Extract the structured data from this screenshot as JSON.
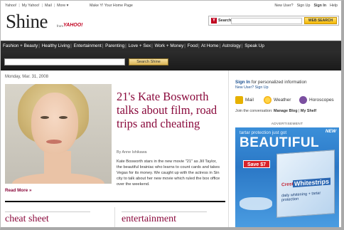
{
  "topbar": {
    "links": [
      "Yahoo!",
      "My Yahoo!",
      "Mail",
      "More ▾"
    ],
    "make_home": "Make Y! Your Home Page",
    "new_user": "New User?",
    "sign_up": "Sign Up",
    "sign_in": "Sign In",
    "help": "Help"
  },
  "brand": {
    "logo": "Shine",
    "from": "from",
    "yahoo": "YAHOO!"
  },
  "web_search": {
    "label": "Search",
    "value": "",
    "button": "WEB SEARCH"
  },
  "nav": {
    "items": [
      "Fashion + Beauty",
      "Healthy Living",
      "Entertainment",
      "Parenting",
      "Love + Sex",
      "Work + Money",
      "Food",
      "At Home",
      "Astrology",
      "Speak Up"
    ]
  },
  "site_search": {
    "value": "",
    "button": "Search Shine"
  },
  "main": {
    "date": "Monday, Mar. 31, 2008",
    "headline": "21's Kate Bosworth talks about film, road trips and cheating",
    "byline": "By Anne Ishikawa",
    "body": "Kate Bosworth stars in the new movie \"21\" as Jill Taylor, the beautiful brainiac who learns to count cards and takes Vegas for its money. We caught up with the actress in Sin city to talk about her new movie which ruled the box office over the weekend.",
    "read_more": "Read More »",
    "sections": [
      "cheat sheet",
      "entertainment"
    ]
  },
  "sidebar": {
    "sign_in_link": "Sign In",
    "sign_in_text": "for personalized information",
    "new_user_link": "New User? Sign Up",
    "icons": [
      {
        "label": "Mail",
        "icon": "mail-icon",
        "color": "#e6b100"
      },
      {
        "label": "Weather",
        "icon": "weather-icon",
        "color": "#f2a900"
      },
      {
        "label": "Horoscopes",
        "icon": "horoscopes-icon",
        "color": "#7b4fa0"
      }
    ],
    "join_text": "Join the conversation:",
    "manage_blog": "Manage Blog",
    "my_shelf": "My Shelf"
  },
  "ad": {
    "label": "ADVERTISEMENT",
    "tagline": "tartar protection just got",
    "headline": "BEAUTIFUL",
    "new_badge": "NEW",
    "save": "Save $7",
    "brand": "Crest",
    "product": "Whitestrips",
    "sub": "daily whitening + tartar protection"
  },
  "colors": {
    "accent": "#8a0a3c",
    "nav_bg": "#2b2b2b",
    "link": "#1a4f8f"
  }
}
